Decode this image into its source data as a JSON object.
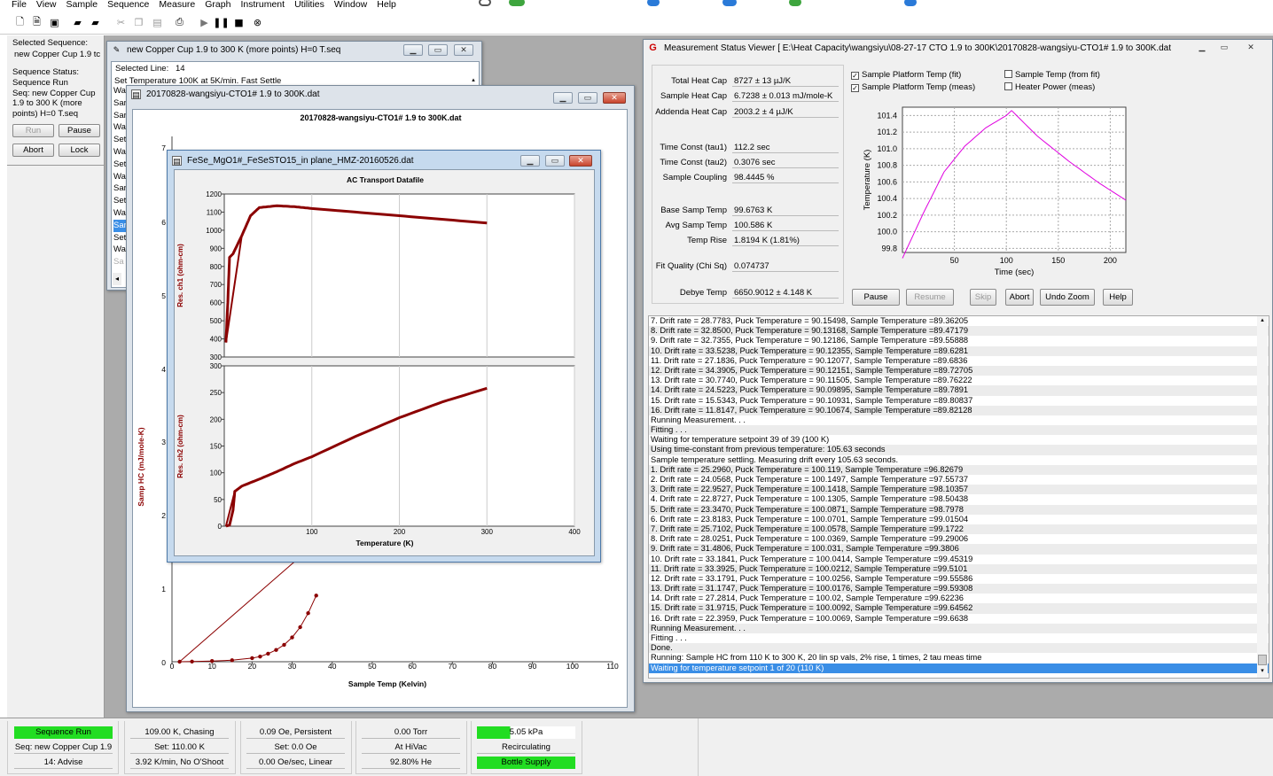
{
  "menu": [
    "File",
    "View",
    "Sample",
    "Sequence",
    "Measure",
    "Graph",
    "Instrument",
    "Utilities",
    "Window",
    "Help"
  ],
  "left": {
    "selected_seq_label": "Selected Sequence:",
    "selected_seq": "new Copper Cup 1.9 tc",
    "status_label": "Sequence Status:",
    "status": "Sequence Run\nSeq: new Copper Cup\n1.9 to 300 K (more\npoints) H=0 T.seq",
    "run": "Run",
    "pause": "Pause",
    "abort": "Abort",
    "lock": "Lock"
  },
  "seqwin": {
    "title": "new Copper Cup 1.9 to 300 K (more points) H=0 T.seq",
    "selected_line_label": "Selected Line:",
    "selected_line": "14",
    "line1": "Set Temperature 100K at 5K/min. Fast Settle",
    "stubs": [
      "Wa",
      "Sar",
      "Sar",
      "Wa",
      "Set",
      "Wa",
      "Set",
      "Wa",
      "Sar",
      "Set",
      "Wa",
      "Sar",
      "Set",
      "Wa",
      "Sa"
    ]
  },
  "hcwin": {
    "title": "20170828-wangsiyu-CTO1# 1.9 to 300K.dat",
    "plot_title": "20170828-wangsiyu-CTO1# 1.9 to 300K.dat",
    "ylabel": "Samp HC (mJ/mole-K)",
    "xlabel": "Sample Temp (Kelvin)",
    "xticks": [
      "0",
      "10",
      "20",
      "30",
      "40",
      "50",
      "60",
      "70",
      "80",
      "90",
      "100",
      "110"
    ],
    "ytick_1": "1",
    "ytick_0": "0",
    "ytick_7": "7",
    "ytick_6": "6",
    "ytick_5": "5",
    "ytick_4": "4",
    "ytick_3": "3",
    "ytick_2": "2"
  },
  "acwin": {
    "title": "FeSe_MgO1#_FeSeSTO15_in plane_HMZ-20160526.dat",
    "plot_title": "AC Transport Datafile",
    "ylabel1": "Res. ch1 (ohm-cm)",
    "ylabel2": "Res. ch2 (ohm-cm)",
    "xlabel": "Temperature (K)",
    "yticks1": [
      "1200",
      "1100",
      "1000",
      "900",
      "800",
      "700",
      "600",
      "500",
      "400",
      "300"
    ],
    "yticks2": [
      "300",
      "250",
      "200",
      "150",
      "100",
      "50",
      "0"
    ],
    "xticks": [
      "100",
      "200",
      "300",
      "400"
    ]
  },
  "mswin": {
    "title": "Measurement Status Viewer [ E:\\Heat Capacity\\wangsiyu\\08-27-17 CTO 1.9 to 300K\\20170828-wangsiyu-CTO1# 1.9 to 300K.dat",
    "rows": [
      {
        "label": "Total Heat Cap",
        "value": "8727 ± 13 µJ/K"
      },
      {
        "label": "Sample Heat Cap",
        "value": "6.7238 ± 0.013 mJ/mole-K"
      },
      {
        "label": "Addenda Heat Cap",
        "value": "2003.2 ± 4 µJ/K"
      },
      {
        "label": "Time Const (tau1)",
        "value": "112.2 sec"
      },
      {
        "label": "Time Const (tau2)",
        "value": "0.3076 sec"
      },
      {
        "label": "Sample Coupling",
        "value": "98.4445 %"
      },
      {
        "label": "Base Samp Temp",
        "value": "99.6763 K"
      },
      {
        "label": "Avg Samp Temp",
        "value": "100.586 K"
      },
      {
        "label": "Temp Rise",
        "value": "1.8194 K  (1.81%)"
      },
      {
        "label": "Fit Quality (Chi Sq)",
        "value": "0.074737"
      },
      {
        "label": "Debye Temp",
        "value": "6650.9012 ± 4.148 K"
      }
    ],
    "checks": [
      {
        "label": "Sample Platform Temp (fit)",
        "checked": "✓"
      },
      {
        "label": "Sample Platform Temp (meas)",
        "checked": "✓"
      },
      {
        "label": "Sample Temp (from fit)",
        "checked": ""
      },
      {
        "label": "Heater Power (meas)",
        "checked": ""
      }
    ],
    "plot": {
      "ylabel": "Temperature (K)",
      "xlabel": "Time (sec)",
      "yticks": [
        "101.4",
        "101.2",
        "101.0",
        "100.8",
        "100.6",
        "100.4",
        "100.2",
        "100.0",
        "99.8"
      ],
      "xticks": [
        "50",
        "100",
        "150",
        "200"
      ]
    },
    "buttons": {
      "pause": "Pause",
      "resume": "Resume",
      "skip": "Skip",
      "abort": "Abort",
      "undo_zoom": "Undo Zoom",
      "help": "Help"
    },
    "log": [
      "7. Drift rate = 28.7783, Puck Temperature = 90.15498, Sample Temperature =89.36205",
      "8. Drift rate = 32.8500, Puck Temperature = 90.13168, Sample Temperature =89.47179",
      "9. Drift rate = 32.7355, Puck Temperature = 90.12186, Sample Temperature =89.55888",
      "10. Drift rate = 33.5238, Puck Temperature = 90.12355, Sample Temperature =89.6281",
      "11. Drift rate = 27.1836, Puck Temperature = 90.12077, Sample Temperature =89.6836",
      "12. Drift rate = 34.3905, Puck Temperature = 90.12151, Sample Temperature =89.72705",
      "13. Drift rate = 30.7740, Puck Temperature = 90.11505, Sample Temperature =89.76222",
      "14. Drift rate = 24.5223, Puck Temperature = 90.09895, Sample Temperature =89.7891",
      "15. Drift rate = 15.5343, Puck Temperature = 90.10931, Sample Temperature =89.80837",
      "16. Drift rate = 11.8147, Puck Temperature = 90.10674, Sample Temperature =89.82128",
      "Running Measurement. . .",
      "Fitting . . .",
      "Waiting for temperature setpoint 39 of 39 (100 K)",
      "Using time-constant from previous temperature: 105.63 seconds",
      "Sample temperature settling.  Measuring drift every 105.63 seconds.",
      "1. Drift rate = 25.2960, Puck Temperature = 100.119, Sample Temperature =96.82679",
      "2. Drift rate = 24.0568, Puck Temperature = 100.1497, Sample Temperature =97.55737",
      "3. Drift rate = 22.9527, Puck Temperature = 100.1418, Sample Temperature =98.10357",
      "4. Drift rate = 22.8727, Puck Temperature = 100.1305, Sample Temperature =98.50438",
      "5. Drift rate = 23.3470, Puck Temperature = 100.0871, Sample Temperature =98.7978",
      "6. Drift rate = 23.8183, Puck Temperature = 100.0701, Sample Temperature =99.01504",
      "7. Drift rate = 25.7102, Puck Temperature = 100.0578, Sample Temperature =99.1722",
      "8. Drift rate = 28.0251, Puck Temperature = 100.0369, Sample Temperature =99.29006",
      "9. Drift rate = 31.4806, Puck Temperature = 100.031, Sample Temperature =99.3806",
      "10. Drift rate = 33.1841, Puck Temperature = 100.0414, Sample Temperature =99.45319",
      "11. Drift rate = 33.3925, Puck Temperature = 100.0212, Sample Temperature =99.5101",
      "12. Drift rate = 33.1791, Puck Temperature = 100.0256, Sample Temperature =99.55586",
      "13. Drift rate = 31.1747, Puck Temperature = 100.0176, Sample Temperature =99.59308",
      "14. Drift rate = 27.2814, Puck Temperature = 100.02, Sample Temperature =99.62236",
      "15. Drift rate = 31.9715, Puck Temperature = 100.0092, Sample Temperature =99.64562",
      "16. Drift rate = 22.3959, Puck Temperature = 100.0069, Sample Temperature =99.6638",
      "Running Measurement. . .",
      "Fitting . . .",
      "Done.",
      "Running: Sample HC from 110 K to 300 K, 20 lin sp vals, 2% rise, 1 times, 2 tau meas time",
      "Waiting for temperature setpoint 1 of 20 (110 K)"
    ]
  },
  "status": {
    "c1": [
      "Sequence Run",
      "Seq: new Copper Cup 1.9",
      "14: Advise"
    ],
    "c2": [
      "109.00 K, Chasing",
      "Set: 110.00 K",
      "3.92 K/min, No O'Shoot"
    ],
    "c3": [
      "0.09 Oe, Persistent",
      "Set: 0.0 Oe",
      "0.00 Oe/sec, Linear"
    ],
    "c4": [
      "0.00 Torr",
      "At HiVac",
      "92.80% He"
    ],
    "c5": [
      "5.05 kPa",
      "Recirculating",
      "Bottle Supply"
    ]
  },
  "chart_data": [
    {
      "type": "line",
      "title": "AC Transport Datafile",
      "xlabel": "Temperature (K)",
      "ylabel": "Res. ch1 (ohm-cm)",
      "xlim": [
        0,
        400
      ],
      "ylim": [
        300,
        1200
      ],
      "x": [
        1.9,
        4,
        6,
        10,
        20,
        30,
        40,
        60,
        80,
        100,
        150,
        200,
        250,
        300
      ],
      "values": [
        380,
        600,
        850,
        870,
        970,
        1080,
        1125,
        1135,
        1130,
        1120,
        1100,
        1080,
        1060,
        1040
      ]
    },
    {
      "type": "line",
      "xlabel": "Temperature (K)",
      "ylabel": "Res. ch2 (ohm-cm)",
      "xlim": [
        0,
        400
      ],
      "ylim": [
        0,
        300
      ],
      "x": [
        1.9,
        6,
        10,
        12,
        20,
        40,
        60,
        80,
        100,
        150,
        200,
        250,
        300
      ],
      "values": [
        0,
        2,
        30,
        65,
        75,
        88,
        102,
        117,
        130,
        168,
        203,
        233,
        258
      ]
    },
    {
      "type": "line",
      "title": "20170828-wangsiyu-CTO1# 1.9 to 300K.dat",
      "xlabel": "Sample Temp (Kelvin)",
      "ylabel": "Samp HC (mJ/mole-K)",
      "xlim": [
        0,
        110
      ],
      "x": [
        1.9,
        5,
        10,
        15,
        20,
        22,
        24,
        26,
        28,
        30,
        32,
        34,
        36
      ],
      "values": [
        0,
        0.003,
        0.01,
        0.02,
        0.05,
        0.07,
        0.11,
        0.16,
        0.23,
        0.33,
        0.47,
        0.66,
        0.9
      ]
    },
    {
      "type": "line",
      "xlabel": "Time (sec)",
      "ylabel": "Temperature (K)",
      "xlim": [
        0,
        215
      ],
      "ylim": [
        99.75,
        101.5
      ],
      "series": [
        {
          "x": [
            0,
            20,
            40,
            60,
            80,
            100,
            105
          ],
          "values": [
            99.68,
            100.22,
            100.72,
            101.03,
            101.25,
            101.4,
            101.46
          ]
        },
        {
          "x": [
            105,
            130,
            160,
            190,
            215
          ],
          "values": [
            101.46,
            101.15,
            100.85,
            100.58,
            100.38
          ]
        }
      ]
    }
  ]
}
